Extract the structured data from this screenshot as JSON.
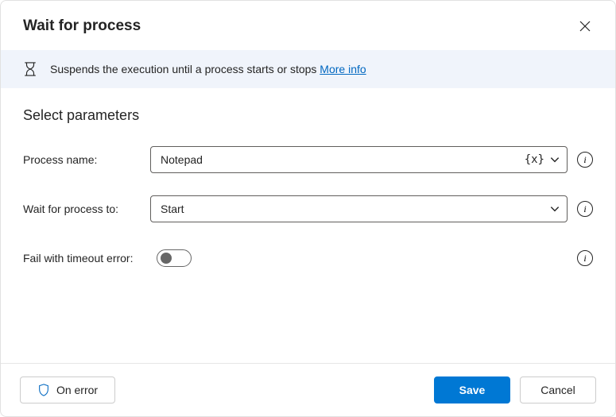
{
  "title": "Wait for process",
  "banner": {
    "text": "Suspends the execution until a process starts or stops ",
    "link": "More info"
  },
  "section_title": "Select parameters",
  "fields": {
    "process_name": {
      "label": "Process name:",
      "value": "Notepad",
      "var_token": "{x}"
    },
    "wait_for": {
      "label": "Wait for process to:",
      "value": "Start"
    },
    "fail_timeout": {
      "label": "Fail with timeout error:",
      "on": false
    }
  },
  "footer": {
    "on_error": "On error",
    "save": "Save",
    "cancel": "Cancel"
  }
}
